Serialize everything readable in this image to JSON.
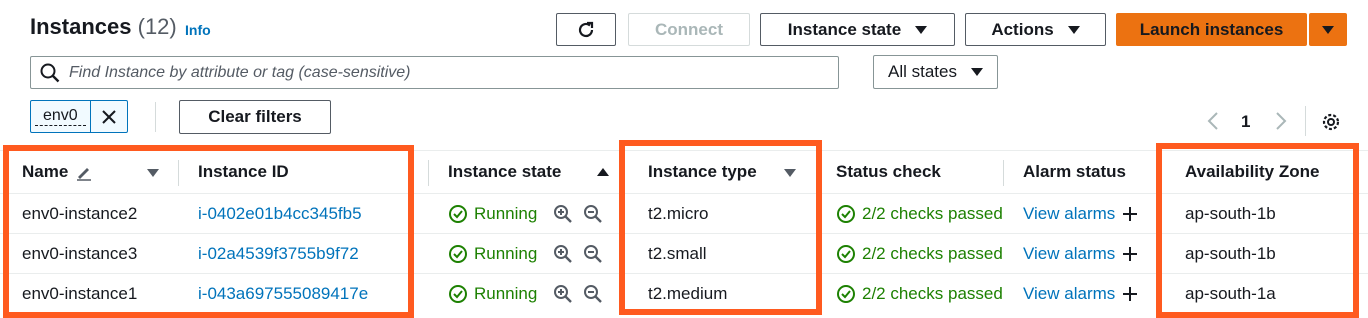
{
  "header": {
    "title": "Instances",
    "count": "(12)",
    "info": "Info",
    "connect": "Connect",
    "instance_state": "Instance state",
    "actions": "Actions",
    "launch": "Launch instances"
  },
  "search": {
    "placeholder": "Find Instance by attribute or tag (case-sensitive)"
  },
  "states_filter": "All states",
  "filter_token": "env0",
  "clear_filters": "Clear filters",
  "pagination": {
    "page": "1"
  },
  "columns": {
    "name": "Name",
    "instance_id": "Instance ID",
    "instance_state": "Instance state",
    "instance_type": "Instance type",
    "status_check": "Status check",
    "alarm_status": "Alarm status",
    "availability_zone": "Availability Zone"
  },
  "rows": [
    {
      "name": "env0-instance2",
      "id": "i-0402e01b4cc345fb5",
      "state": "Running",
      "type": "t2.micro",
      "status": "2/2 checks passed",
      "alarm": "View alarms",
      "az": "ap-south-1b"
    },
    {
      "name": "env0-instance3",
      "id": "i-02a4539f3755b9f72",
      "state": "Running",
      "type": "t2.small",
      "status": "2/2 checks passed",
      "alarm": "View alarms",
      "az": "ap-south-1b"
    },
    {
      "name": "env0-instance1",
      "id": "i-043a697555089417e",
      "state": "Running",
      "type": "t2.medium",
      "status": "2/2 checks passed",
      "alarm": "View alarms",
      "az": "ap-south-1a"
    }
  ],
  "colors": {
    "link": "#0073bb",
    "running": "#1d8102",
    "primary": "#ec7211",
    "highlight": "#ff5a1f"
  }
}
